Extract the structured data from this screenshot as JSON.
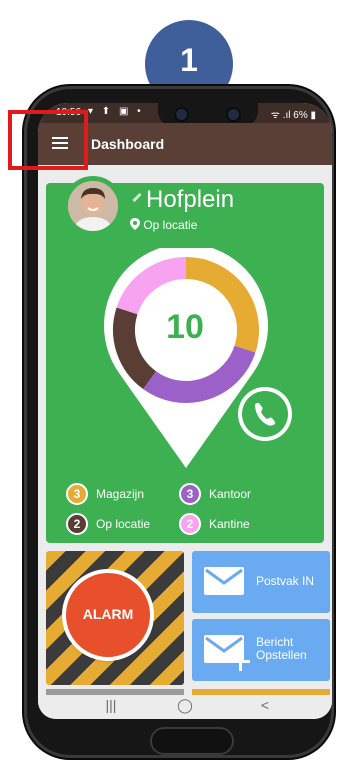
{
  "step_badge": "1",
  "statusbar": {
    "time": "10:56",
    "notifications": "▾ ⬆ ▣ •",
    "right": "ᯤ .ıl 6% ▮"
  },
  "appbar": {
    "title": "Dashboard",
    "menu_icon": "hamburger-menu-icon"
  },
  "location": {
    "name": "Hofplein",
    "status": "Op locatie",
    "count": "10",
    "colors": {
      "card": "#3db152",
      "magazijn": "#e6ab33",
      "kantoor": "#9b61c9",
      "op_locatie": "#5a3d35",
      "kantine": "#f8a3f2"
    }
  },
  "chart_data": {
    "type": "pie",
    "categories": [
      "Magazijn",
      "Kantoor",
      "Op locatie",
      "Kantine"
    ],
    "values": [
      3,
      3,
      2,
      2
    ],
    "colors": [
      "#e6ab33",
      "#9b61c9",
      "#5a3d35",
      "#f8a3f2"
    ]
  },
  "legend": [
    {
      "count": "3",
      "label": "Magazijn",
      "color": "#e6ab33"
    },
    {
      "count": "3",
      "label": "Kantoor",
      "color": "#9b61c9"
    },
    {
      "count": "2",
      "label": "Op locatie",
      "color": "#5a3d35"
    },
    {
      "count": "2",
      "label": "Kantine",
      "color": "#f8a3f2"
    }
  ],
  "tiles": {
    "alarm": "ALARM",
    "postvak": "Postvak IN",
    "bericht_line1": "Bericht",
    "bericht_line2": "Opstellen"
  },
  "navbar": {
    "recent": "|||",
    "home": "◯",
    "back": "<"
  }
}
